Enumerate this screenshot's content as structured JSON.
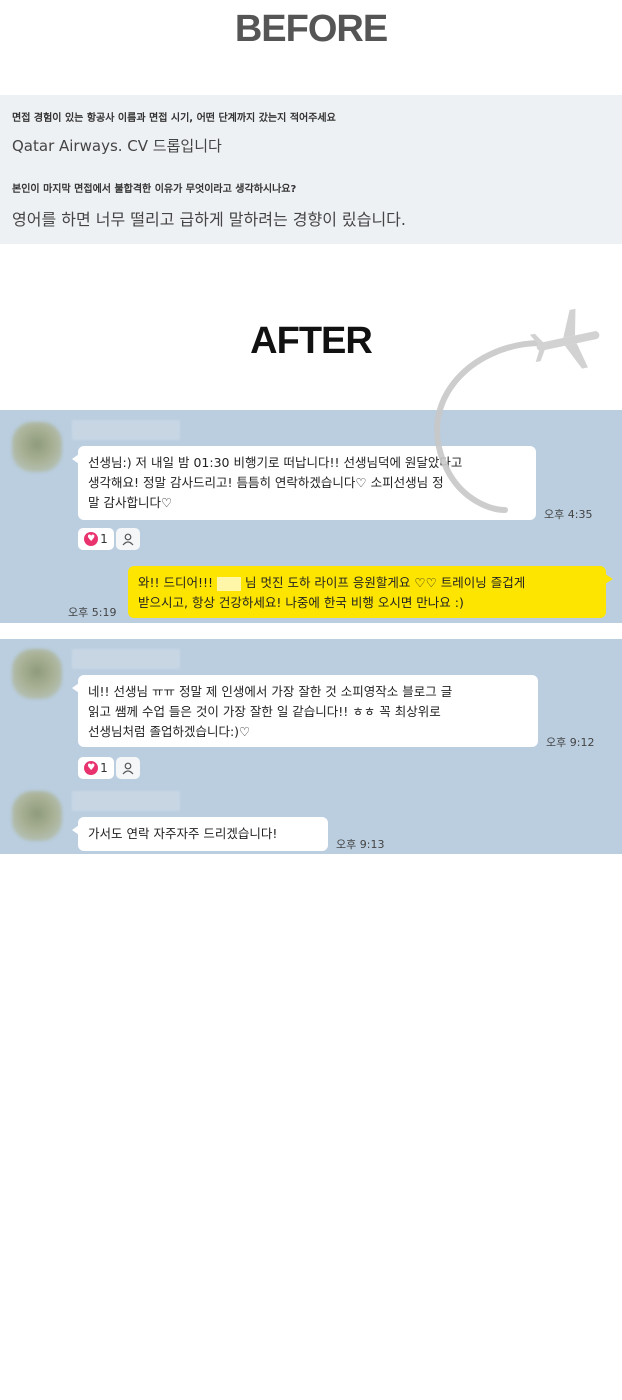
{
  "before": {
    "heading": "BEFORE",
    "q1": "면접 경험이 있는 항공사 이름과 면접 시기, 어떤 단계까지 갔는지 적어주세요",
    "a1": "Qatar Airways. CV 드롭입니다",
    "q2": "본인이 마지막 면접에서 불합격한 이유가 무엇이라고 생각하시나요?",
    "a2": "영어를 하면 너무 떨리고 급하게 말하려는 경향이 맀습니다."
  },
  "after": {
    "heading": "AFTER"
  },
  "chat1": {
    "message1": {
      "lines": [
        "선생님:) 저 내일 밤 01:30 비행기로 떠납니다!! 선생님덕에 원달았다고",
        "생각해요! 정말 감사드리고! 틈틈히 연락하겠습니다♡ 소피선생님 정",
        "말 감사합니다♡"
      ],
      "time": "오후 4:35",
      "reaction_count": "1"
    },
    "reply": {
      "line1_before": "와!! 드디어!!!",
      "line1_after": "님 멋진 도하 라이프 응원할게요 ♡♡ 트레이닝 즐겁게",
      "line2": "받으시고, 항상 건강하세요! 나중에 한국 비행 오시면 만나요 :)",
      "time": "오후 5:19"
    }
  },
  "chat2": {
    "message1": {
      "lines": [
        "네!! 선생님 ㅠㅠ 정말 제 인생에서 가장 잘한 것 소피영작소 블로그 글",
        "읽고 쌤께 수업 들은 것이 가장 잘한 일 같습니다!! ㅎㅎ 꼭 최상위로",
        "선생님처럼 졸업하겠습니다:)♡"
      ],
      "time": "오후 9:12",
      "reaction_count": "1"
    },
    "message2": {
      "text": "가서도 연락 자주자주 드리겠습니다!",
      "time": "오후 9:13"
    }
  },
  "colors": {
    "chat_background": "#bacee0",
    "outgoing_bubble": "#fee500",
    "incoming_bubble": "#ffffff",
    "heart_badge": "#e8336f",
    "survey_background": "#eef1f4"
  },
  "icons": [
    "heart-icon",
    "person-icon",
    "airplane-icon"
  ]
}
